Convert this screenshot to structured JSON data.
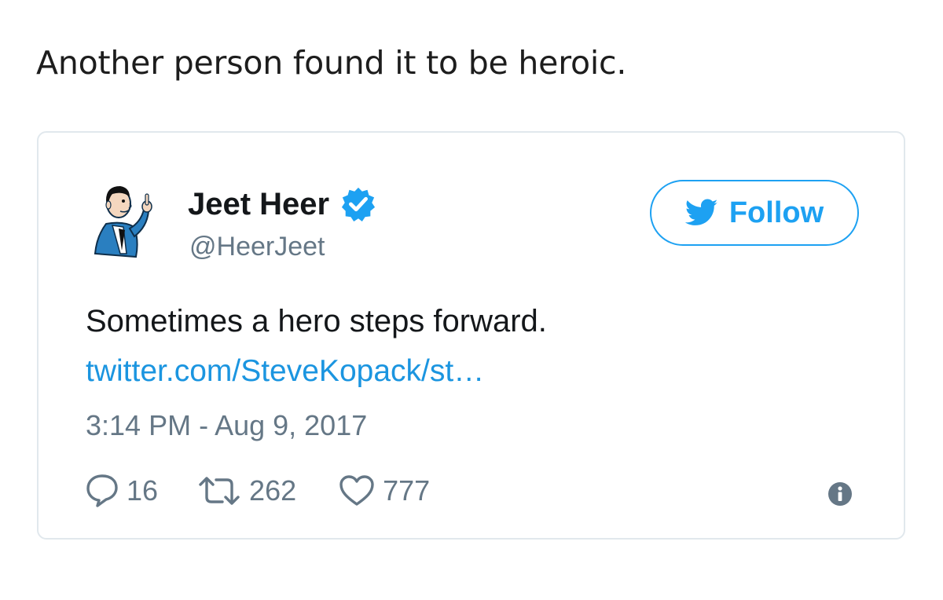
{
  "caption": "Another person found it to be heroic.",
  "tweet": {
    "author": {
      "name": "Jeet Heer",
      "handle": "@HeerJeet",
      "verified": true,
      "avatar_icon": "cartoon-man-pointing-avatar"
    },
    "follow_label": "Follow",
    "text": "Sometimes a hero steps forward.",
    "link_text": "twitter.com/SteveKopack/st…",
    "timestamp": "3:14 PM - Aug 9, 2017",
    "stats": {
      "replies": "16",
      "retweets": "262",
      "likes": "777"
    },
    "icons": {
      "reply": "speech-bubble-icon",
      "retweet": "retweet-arrows-icon",
      "like": "heart-icon",
      "info": "info-icon",
      "verified": "verified-badge-icon",
      "follow": "twitter-bird-icon"
    }
  },
  "colors": {
    "brand_blue": "#1da1f2",
    "link_blue": "#1b95e0",
    "secondary_text": "#657786",
    "border": "#e1e8ed"
  }
}
